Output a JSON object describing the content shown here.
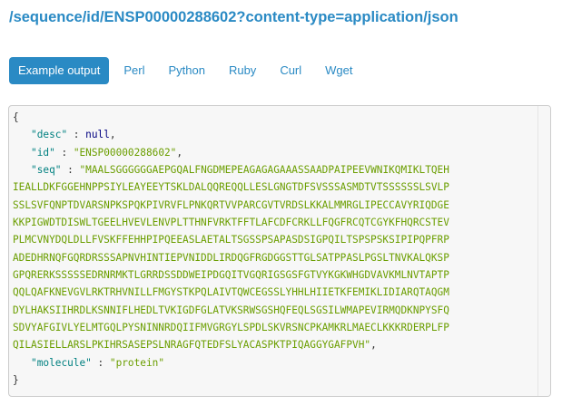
{
  "endpoint": "/sequence/id/ENSP00000288602?content-type=application/json",
  "tabs": [
    {
      "label": "Example output",
      "active": true
    },
    {
      "label": "Perl",
      "active": false
    },
    {
      "label": "Python",
      "active": false
    },
    {
      "label": "Ruby",
      "active": false
    },
    {
      "label": "Curl",
      "active": false
    },
    {
      "label": "Wget",
      "active": false
    }
  ],
  "output": {
    "open_brace": "{",
    "close_brace": "}",
    "desc_key": "\"desc\"",
    "desc_value": "null",
    "id_key": "\"id\"",
    "id_value": "\"ENSP00000288602\"",
    "seq_key": "\"seq\"",
    "seq_lines": [
      "\"MAALSGGGGGGAEPGQALFNGDMEPEAGAGAGAAASSAADPAIPEEVWNIKQMIKLTQEH",
      "IEALLDKFGGEHNPPSIYLEAYEEYTSKLDALQQREQQLLESLGNGTDFSVSSSASMDTVTSSSSSSLSVLP",
      "SSLSVFQNPTDVARSNPKSPQKPIVRVFLPNKQRTVVPARCGVTVRDSLKKALMMRGLIPECCAVYRIQDGE",
      "KKPIGWDTDISWLTGEELHVEVLENVPLTTHNFVRKTFFTLAFCDFCRKLLFQGFRCQTCGYKFHQRCSTEV",
      "PLMCVNYDQLDLLFVSKFFEHHPIPQEEASLAETALTSGSSPSAPASDSIGPQILTSPSPSKSIPIPQPFRP",
      "ADEDHRNQFGQRDRSSSAPNVHINTIEPVNIDDLIRDQGFRGDGGSTTGLSATPPASLPGSLTNVKALQKSP",
      "GPQRERKSSSSSEDRNRMKTLGRRDSSDDWEIPDGQITVGQRIGSGSFGTVYKGKWHGDVAVKMLNVTAPTP",
      "QQLQAFKNEVGVLRKTRHVNILLFMGYSTKPQLAIVTQWCEGSSLYHHLHIIETKFEMIKLIDIARQTAQGM",
      "DYLHAKSIIHRDLKSNNIFLHEDLTVKIGDFGLATVKSRWSGSHQFEQLSGSILWMAPEVIRMQDKNPYSFQ",
      "SDVYAFGIVLYELMTGQLPYSNINNRDQIIFMVGRGYLSPDLSKVRSNCPKAMKRLMAECLKKKRDERPLFP",
      "QILASIELLARSLPKIHRSASEPSLNRAGFQTEDFSLYACASPKTPIQAGGYGAFPVH\""
    ],
    "molecule_key": "\"molecule\"",
    "molecule_value": "\"protein\""
  }
}
